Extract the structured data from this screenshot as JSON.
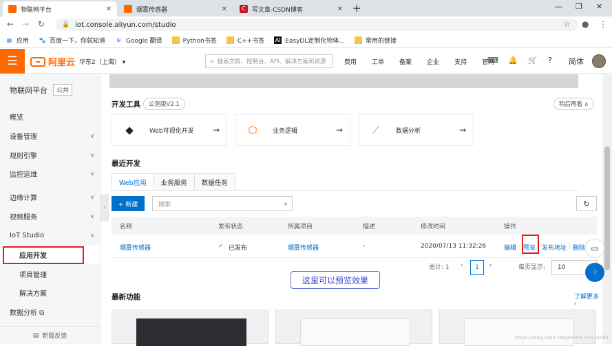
{
  "browser": {
    "tabs": [
      {
        "title": "物联网平台",
        "color": "#ff6a00"
      },
      {
        "title": "烟雾传感器",
        "color": "#ff6a00"
      },
      {
        "title": "写文章-CSDN博客",
        "color": "#c8161d"
      }
    ],
    "url": "iot.console.aliyun.com/studio",
    "bookmarks": [
      "应用",
      "百度一下，你就知道",
      "Google 翻译",
      "Python书签",
      "C++书签",
      "EasyDL定制化物体...",
      "常用的链接"
    ]
  },
  "header": {
    "logo": "阿里云",
    "region": "华东2（上海）",
    "search_placeholder": "搜索文档、控制台、API、解决方案和资源",
    "links": [
      "费用",
      "工单",
      "备案",
      "企业",
      "支持",
      "官网"
    ],
    "lang": "简体"
  },
  "sidebar": {
    "title": "物联网平台",
    "tag": "公共",
    "items": [
      {
        "label": "概览",
        "chevron": ""
      },
      {
        "label": "设备管理",
        "chevron": "∨"
      },
      {
        "label": "规则引擎",
        "chevron": "∨"
      },
      {
        "label": "监控运维",
        "chevron": "∨"
      },
      {
        "label": "边缘计算",
        "chevron": "∨"
      },
      {
        "label": "视频服务",
        "chevron": "∨"
      },
      {
        "label": "IoT Studio",
        "chevron": "∧"
      },
      {
        "label": "应用开发",
        "chevron": ""
      },
      {
        "label": "项目管理",
        "chevron": ""
      },
      {
        "label": "解决方案",
        "chevron": ""
      },
      {
        "label": "数据分析 ⧉",
        "chevron": ""
      }
    ],
    "footer": "新版反馈"
  },
  "devtools": {
    "title": "开发工具",
    "version": "公测版V2.1",
    "later": "稍后再看",
    "cards": [
      "Web可视化开发",
      "业务逻辑",
      "数据分析"
    ]
  },
  "recent": {
    "title": "最近开发",
    "tabs": [
      "Web应用",
      "业务服务",
      "数据任务"
    ],
    "new_btn": "+ 新建",
    "search_placeholder": "搜索",
    "columns": [
      "名称",
      "发布状态",
      "所属项目",
      "描述",
      "修改时间",
      "操作"
    ],
    "row": {
      "name": "烟雾传感器",
      "status": "已发布",
      "project": "烟雾传感器",
      "desc": "-",
      "modified": "2020/07/13 11:32:26",
      "actions": [
        "编辑",
        "预览",
        "发布地址",
        "删除"
      ]
    },
    "total": "总计: 1",
    "page": "1",
    "page_size_label": "每页显示:",
    "page_size": "10"
  },
  "annotation": "这里可以预览效果",
  "newfeatures": {
    "title": "最新功能",
    "more": "了解更多"
  },
  "watermark": "https://blog.csdn.net/weixin_43116561"
}
